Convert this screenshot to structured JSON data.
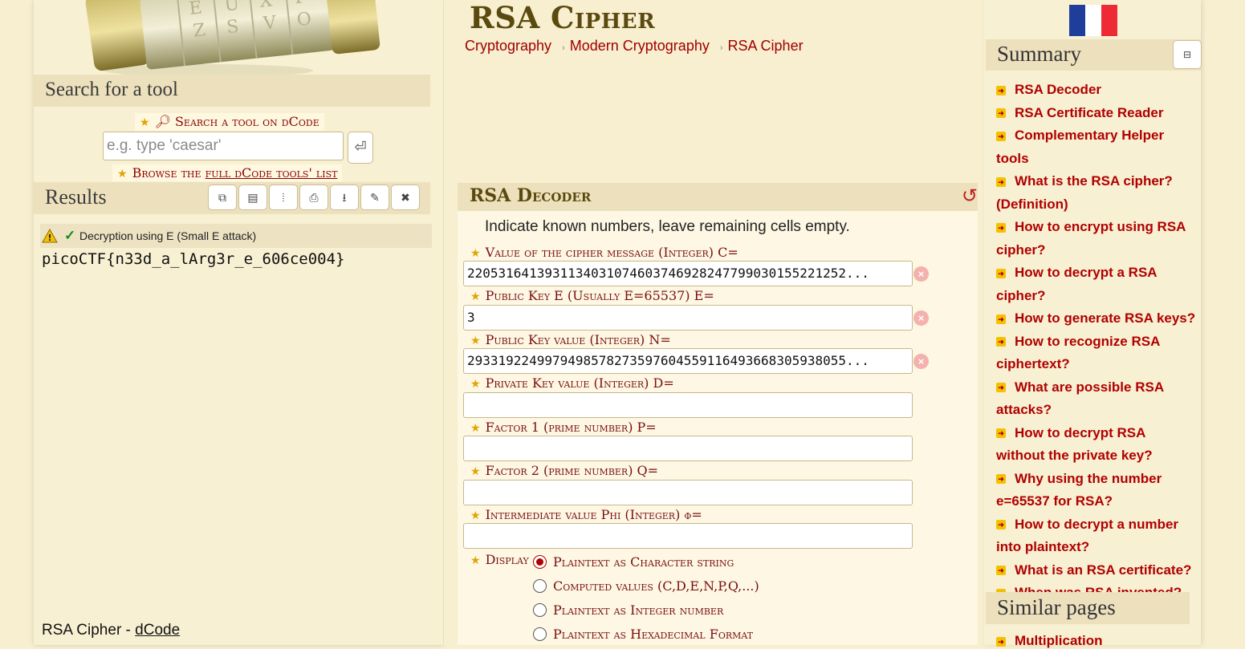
{
  "search": {
    "header": "Search for a tool",
    "link": "Search a tool on dCode",
    "placeholder": "e.g. type 'caesar'",
    "submit_icon": "⏎",
    "browse_prefix": "Browse the ",
    "browse_link": "full dCode tools' list"
  },
  "results": {
    "header": "Results",
    "toolbar_icons": [
      "copy-icon",
      "notes-icon",
      "split-icon",
      "print-icon",
      "download-icon",
      "pin-icon",
      "close-icon"
    ],
    "line_label": "Decryption using E (Small E attack)",
    "output": "picoCTF{n33d_a_lArg3r_e_606ce004}"
  },
  "footer": {
    "text": "RSA Cipher - ",
    "link": "dCode"
  },
  "page": {
    "title": "RSA Cipher",
    "breadcrumb": [
      "Cryptography",
      "Modern Cryptography",
      "RSA Cipher"
    ]
  },
  "decoder": {
    "title": "RSA Decoder",
    "hint": "Indicate known numbers, leave remaining cells empty.",
    "fields": [
      {
        "label": "Value of the cipher message (Integer) C=",
        "value": "2205316413931134031074603746928247799030155221252..."
      },
      {
        "label": "Public Key E (Usually E=65537) E=",
        "value": "3"
      },
      {
        "label": "Public Key value (Integer) N=",
        "value": "2933192249979498578273597604559116493668305938055..."
      },
      {
        "label": "Private Key value (Integer) D=",
        "value": ""
      },
      {
        "label": "Factor 1 (prime number) P=",
        "value": ""
      },
      {
        "label": "Factor 2 (prime number) Q=",
        "value": ""
      },
      {
        "label": "Intermediate value Phi (Integer) φ=",
        "value": ""
      }
    ],
    "display_label": "Display",
    "display_options": [
      {
        "label": "Plaintext as Character string",
        "checked": true
      },
      {
        "label": "Computed values (C,D,E,N,P,Q,...)",
        "checked": false
      },
      {
        "label": "Plaintext as Integer number",
        "checked": false
      },
      {
        "label": "Plaintext as Hexadecimal Format",
        "checked": false
      }
    ]
  },
  "summary": {
    "header": "Summary",
    "collapse_icon": "⊟",
    "items": [
      "RSA Decoder",
      "RSA Certificate Reader",
      "Complementary Helper tools",
      "What is the RSA cipher? (Definition)",
      "How to encrypt using RSA cipher?",
      "How to decrypt a RSA cipher?",
      "How to generate RSA keys?",
      "How to recognize RSA ciphertext?",
      "What are possible RSA attacks?",
      "How to decrypt RSA without the private key?",
      "Why using the number e=65537 for RSA?",
      "How to decrypt a number into plaintext?",
      "What is an RSA certificate?",
      "When was RSA invented?"
    ]
  },
  "similar": {
    "header": "Similar pages",
    "first_item": "Multiplication"
  },
  "colors": {
    "background": "#f7efcf",
    "link_red": "#b00000",
    "label_red": "#7a1010",
    "title_brown": "#5a4a10",
    "header_band": "#ede1bd"
  }
}
